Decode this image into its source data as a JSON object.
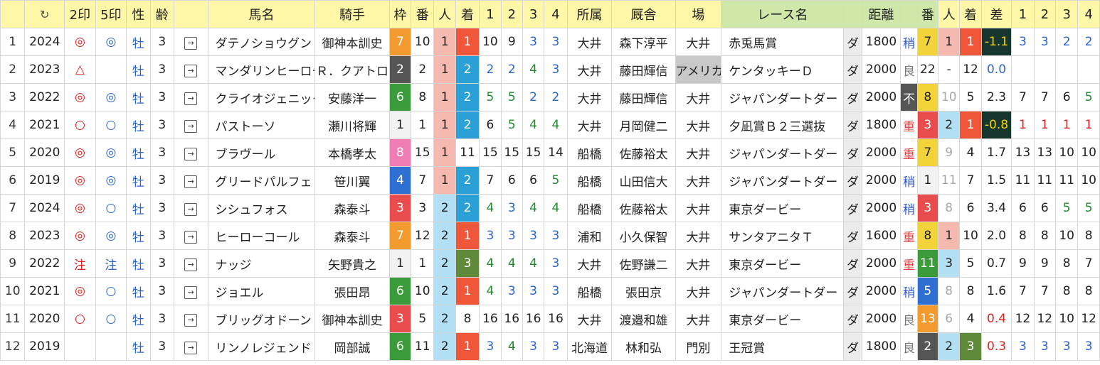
{
  "headers": [
    "↻",
    "2印",
    "5印",
    "性",
    "齢",
    "",
    "馬名",
    "騎手",
    "枠",
    "番",
    "人",
    "着",
    "1",
    "2",
    "3",
    "4",
    "所属",
    "厩舎",
    "場",
    "レース名",
    "",
    "距離",
    "",
    "番",
    "人",
    "着",
    "差",
    "1",
    "2",
    "3",
    "4"
  ],
  "rows": [
    {
      "no": "1",
      "year": "2024",
      "m2": "◎",
      "m5": "◎",
      "sex": "牡",
      "age": "3",
      "horse": "ダテノショウグン",
      "jockey": "御神本訓史",
      "waku": "7",
      "ban": "10",
      "ninki": "1",
      "chaku": "1",
      "p": [
        "10",
        "9",
        "3",
        "3"
      ],
      "shozoku": "大井",
      "kyusha": "森下淳平",
      "ba": "大井",
      "race": "赤兎馬賞",
      "surf": "ダ",
      "dist": "1800",
      "cond": "稍",
      "ban2": "7",
      "ninki2": "1",
      "chaku2": "1",
      "sa": "-1.1",
      "p2": [
        "3",
        "3",
        "2",
        "2"
      ]
    },
    {
      "no": "2",
      "year": "2023",
      "m2": "△",
      "m5": "",
      "sex": "牡",
      "age": "3",
      "horse": "マンダリンヒーロー",
      "jockey": "Ｒ．クアトロ",
      "waku": "2",
      "ban": "2",
      "ninki": "1",
      "chaku": "2",
      "p": [
        "2",
        "2",
        "4",
        "3"
      ],
      "shozoku": "大井",
      "kyusha": "藤田輝信",
      "ba": "アメリカ",
      "race": "ケンタッキーＤ",
      "surf": "ダ",
      "dist": "2000",
      "cond": "良",
      "ban2": "22",
      "ninki2": "-",
      "chaku2": "12",
      "sa": "0.0",
      "p2": [
        "",
        "",
        "",
        ""
      ]
    },
    {
      "no": "3",
      "year": "2022",
      "m2": "◎",
      "m5": "◎",
      "sex": "牡",
      "age": "3",
      "horse": "クライオジェニック",
      "jockey": "安藤洋一",
      "waku": "6",
      "ban": "8",
      "ninki": "1",
      "chaku": "2",
      "p": [
        "5",
        "5",
        "2",
        "2"
      ],
      "shozoku": "大井",
      "kyusha": "藤田輝信",
      "ba": "大井",
      "race": "ジャパンダートダー",
      "surf": "ダ",
      "dist": "2000",
      "cond": "不",
      "ban2": "8",
      "ninki2": "10",
      "chaku2": "5",
      "sa": "2.3",
      "p2": [
        "7",
        "7",
        "6",
        "5"
      ]
    },
    {
      "no": "4",
      "year": "2021",
      "m2": "○",
      "m5": "○",
      "sex": "牡",
      "age": "3",
      "horse": "パストーソ",
      "jockey": "瀬川将輝",
      "waku": "1",
      "ban": "1",
      "ninki": "1",
      "chaku": "2",
      "p": [
        "6",
        "5",
        "4",
        "4"
      ],
      "shozoku": "大井",
      "kyusha": "月岡健二",
      "ba": "大井",
      "race": "夕凪賞Ｂ２三選抜",
      "surf": "ダ",
      "dist": "1800",
      "cond": "重",
      "ban2": "3",
      "ninki2": "2",
      "chaku2": "1",
      "sa": "-0.8",
      "p2": [
        "1",
        "1",
        "1",
        "1"
      ]
    },
    {
      "no": "5",
      "year": "2020",
      "m2": "◎",
      "m5": "◎",
      "sex": "牡",
      "age": "3",
      "horse": "ブラヴール",
      "jockey": "本橋孝太",
      "waku": "8",
      "ban": "15",
      "ninki": "1",
      "chaku": "11",
      "p": [
        "15",
        "15",
        "15",
        "14"
      ],
      "shozoku": "船橋",
      "kyusha": "佐藤裕太",
      "ba": "大井",
      "race": "ジャパンダートダー",
      "surf": "ダ",
      "dist": "2000",
      "cond": "重",
      "ban2": "7",
      "ninki2": "9",
      "chaku2": "4",
      "sa": "1.7",
      "p2": [
        "13",
        "13",
        "10",
        "10"
      ]
    },
    {
      "no": "6",
      "year": "2019",
      "m2": "◎",
      "m5": "◎",
      "sex": "牡",
      "age": "3",
      "horse": "グリードパルフェ",
      "jockey": "笹川翼",
      "waku": "4",
      "ban": "7",
      "ninki": "1",
      "chaku": "2",
      "p": [
        "7",
        "6",
        "6",
        "5"
      ],
      "shozoku": "船橋",
      "kyusha": "山田信大",
      "ba": "大井",
      "race": "ジャパンダートダー",
      "surf": "ダ",
      "dist": "2000",
      "cond": "稍",
      "ban2": "1",
      "ninki2": "11",
      "chaku2": "7",
      "sa": "1.5",
      "p2": [
        "11",
        "11",
        "11",
        "10"
      ]
    },
    {
      "no": "7",
      "year": "2024",
      "m2": "◎",
      "m5": "○",
      "sex": "牡",
      "age": "3",
      "horse": "シシュフォス",
      "jockey": "森泰斗",
      "waku": "3",
      "ban": "3",
      "ninki": "2",
      "chaku": "2",
      "p": [
        "4",
        "3",
        "4",
        "4"
      ],
      "shozoku": "船橋",
      "kyusha": "佐藤裕太",
      "ba": "大井",
      "race": "東京ダービー",
      "surf": "ダ",
      "dist": "2000",
      "cond": "稍",
      "ban2": "3",
      "ninki2": "8",
      "chaku2": "6",
      "sa": "3.4",
      "p2": [
        "6",
        "6",
        "5",
        "5"
      ]
    },
    {
      "no": "8",
      "year": "2023",
      "m2": "◎",
      "m5": "◎",
      "sex": "牡",
      "age": "3",
      "horse": "ヒーローコール",
      "jockey": "森泰斗",
      "waku": "7",
      "ban": "12",
      "ninki": "2",
      "chaku": "1",
      "p": [
        "3",
        "3",
        "3",
        "3"
      ],
      "shozoku": "浦和",
      "kyusha": "小久保智",
      "ba": "大井",
      "race": "サンタアニタＴ",
      "surf": "ダ",
      "dist": "1600",
      "cond": "重",
      "ban2": "8",
      "ninki2": "1",
      "chaku2": "10",
      "sa": "2.0",
      "p2": [
        "8",
        "8",
        "10",
        "8"
      ]
    },
    {
      "no": "9",
      "year": "2022",
      "m2": "注",
      "m5": "注",
      "sex": "牡",
      "age": "3",
      "horse": "ナッジ",
      "jockey": "矢野貴之",
      "waku": "1",
      "ban": "1",
      "ninki": "2",
      "chaku": "3",
      "p": [
        "4",
        "4",
        "4",
        "3"
      ],
      "shozoku": "大井",
      "kyusha": "佐野謙二",
      "ba": "大井",
      "race": "東京ダービー",
      "surf": "ダ",
      "dist": "2000",
      "cond": "重",
      "ban2": "11",
      "ninki2": "3",
      "chaku2": "5",
      "sa": "0.7",
      "p2": [
        "9",
        "9",
        "8",
        "7"
      ]
    },
    {
      "no": "10",
      "year": "2021",
      "m2": "◎",
      "m5": "○",
      "sex": "牡",
      "age": "3",
      "horse": "ジョエル",
      "jockey": "張田昂",
      "waku": "6",
      "ban": "10",
      "ninki": "2",
      "chaku": "1",
      "p": [
        "4",
        "3",
        "3",
        "3"
      ],
      "shozoku": "船橋",
      "kyusha": "張田京",
      "ba": "大井",
      "race": "ジャパンダートダー",
      "surf": "ダ",
      "dist": "2000",
      "cond": "稍",
      "ban2": "5",
      "ninki2": "8",
      "chaku2": "8",
      "sa": "1.6",
      "p2": [
        "7",
        "7",
        "8",
        "8"
      ]
    },
    {
      "no": "11",
      "year": "2020",
      "m2": "○",
      "m5": "○",
      "sex": "牡",
      "age": "3",
      "horse": "ブリッグオドーン",
      "jockey": "御神本訓史",
      "waku": "3",
      "ban": "5",
      "ninki": "2",
      "chaku": "8",
      "p": [
        "16",
        "16",
        "16",
        "16"
      ],
      "shozoku": "大井",
      "kyusha": "渡邉和雄",
      "ba": "大井",
      "race": "東京ダービー",
      "surf": "ダ",
      "dist": "2000",
      "cond": "良",
      "ban2": "13",
      "ninki2": "6",
      "chaku2": "4",
      "sa": "0.4",
      "p2": [
        "12",
        "12",
        "10",
        "12"
      ]
    },
    {
      "no": "12",
      "year": "2019",
      "m2": "",
      "m5": "",
      "sex": "牡",
      "age": "3",
      "horse": "リンノレジェンド",
      "jockey": "岡部誠",
      "waku": "6",
      "ban": "11",
      "ninki": "2",
      "chaku": "1",
      "p": [
        "3",
        "4",
        "3",
        "3"
      ],
      "shozoku": "北海道",
      "kyusha": "林和弘",
      "ba": "門別",
      "race": "王冠賞",
      "surf": "ダ",
      "dist": "1800",
      "cond": "良",
      "ban2": "2",
      "ninki2": "2",
      "chaku2": "3",
      "sa": "0.3",
      "p2": [
        "3",
        "3",
        "3",
        "3"
      ]
    }
  ],
  "colors": {
    "waku": {
      "1": "#f2f2f2",
      "2": "#555555",
      "3": "#e84c4c",
      "4": "#2f6fd1",
      "5": "#f2d43a",
      "6": "#3b9b3b",
      "7": "#f29a2e",
      "8": "#f07cb4"
    },
    "chaku": {
      "1": "#f0573a",
      "2": "#2aa0d6",
      "3": "#5f8a3a"
    },
    "ninki1": "#f6b9b0",
    "ninki2": "#b3dff4",
    "condHeavy": "#e23b3b",
    "condSlight": "#2a52cf",
    "condGood": "#777777",
    "saNeg": "#17362e",
    "saNegText": "#f5d100"
  },
  "icons": {
    "refresh": "refresh-icon",
    "jump": "arrow-into-box-icon"
  }
}
